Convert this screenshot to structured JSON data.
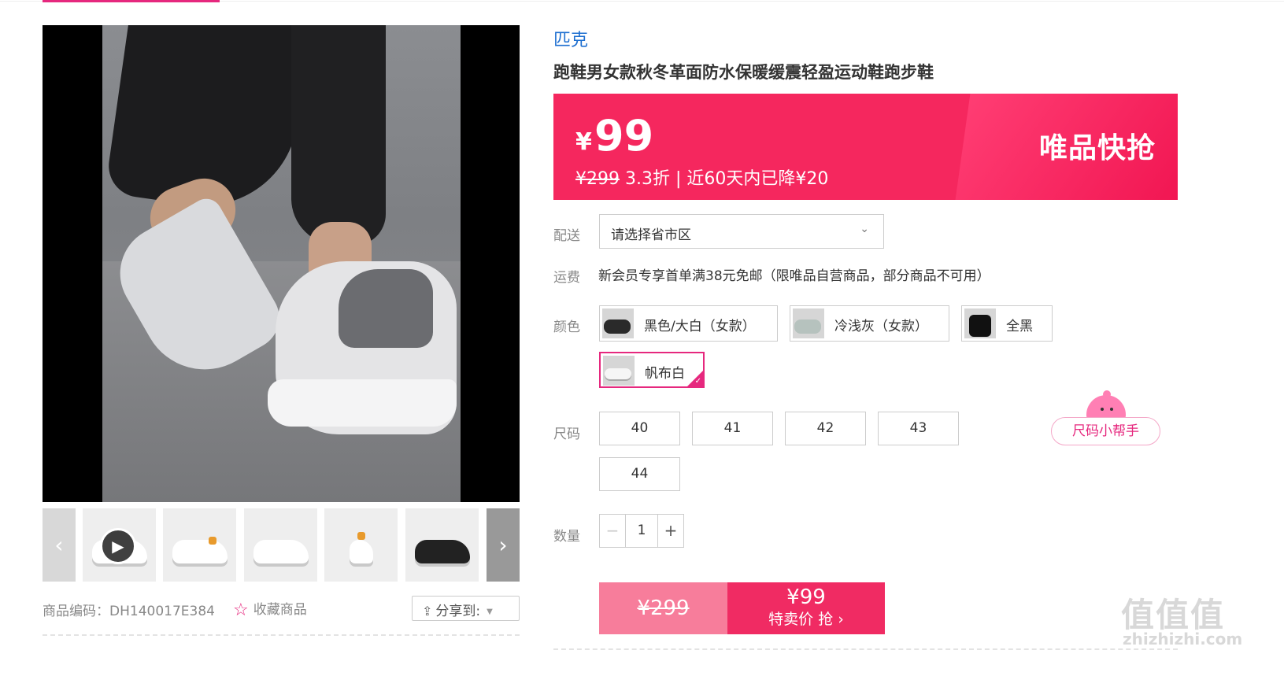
{
  "gallery": {
    "prev_arrow": "‹",
    "next_arrow": "›",
    "play_icon": "▶",
    "goods_code": "商品编码：DH140017E384",
    "favorite_label": "收藏商品",
    "share_label": "分享到:"
  },
  "product": {
    "brand": "匹克",
    "title": "跑鞋男女款秋冬革面防水保暖缓震轻盈运动鞋跑步鞋"
  },
  "price": {
    "currency": "¥",
    "current": "99",
    "original": "¥299",
    "discount_note": " 3.3折 | 近60天内已降¥20",
    "promo_label": "唯品快抢"
  },
  "delivery": {
    "label": "配送",
    "placeholder": "请选择省市区"
  },
  "freight": {
    "label": "运费",
    "text": "新会员专享首单满38元免邮（限唯品自营商品，部分商品不可用）"
  },
  "colors": {
    "label": "颜色",
    "options": [
      {
        "name": "黑色/大白（女款）",
        "selected": false
      },
      {
        "name": "冷浅灰（女款）",
        "selected": false
      },
      {
        "name": "全黑",
        "selected": false
      },
      {
        "name": "帆布白",
        "selected": true
      }
    ]
  },
  "sizes": {
    "label": "尺码",
    "options": [
      "40",
      "41",
      "42",
      "43",
      "44"
    ],
    "helper_label": "尺码小帮手"
  },
  "quantity": {
    "label": "数量",
    "value": "1",
    "minus": "−",
    "plus": "+"
  },
  "buy": {
    "original": "¥299",
    "sale_price": "¥99",
    "sale_text": "特卖价 抢 ›"
  },
  "watermark": {
    "mark": "值值值",
    "site": "zhizhizhi.com"
  },
  "colors_palette": {
    "accent": "#e6287e",
    "banner": "#f5275e",
    "brand_link": "#1e6fd0"
  }
}
